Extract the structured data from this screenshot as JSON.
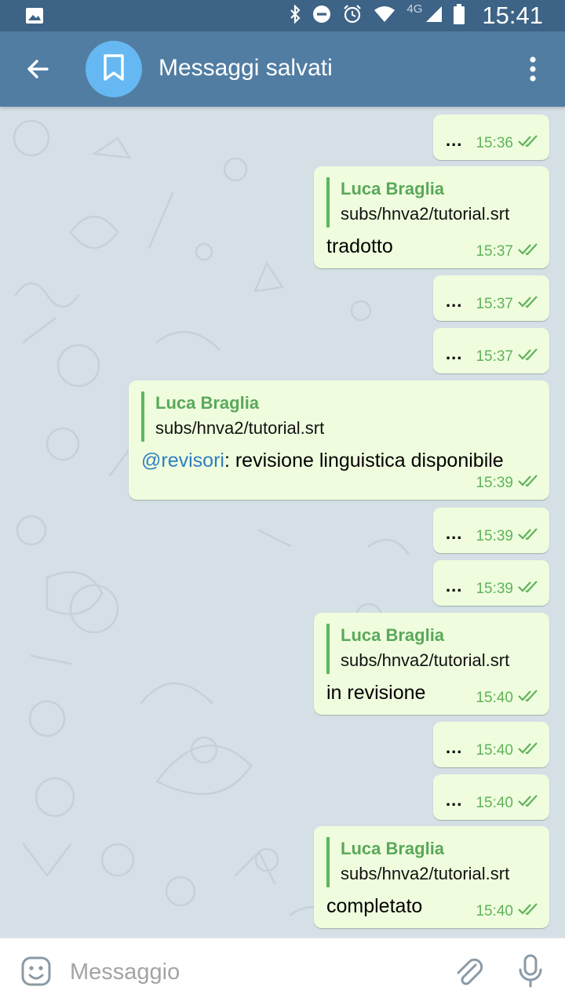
{
  "status_bar": {
    "time": "15:41",
    "network": "4G",
    "icons": [
      "image-icon",
      "bluetooth-icon",
      "dnd-icon",
      "alarm-icon",
      "wifi-icon",
      "signal-icon",
      "battery-icon"
    ]
  },
  "header": {
    "title": "Messaggi salvati",
    "avatar_icon": "bookmark-icon",
    "accent": "#517da2"
  },
  "messages": [
    {
      "type": "dots",
      "text": "...",
      "time": "15:36"
    },
    {
      "type": "reply",
      "reply_name": "Luca Braglia",
      "reply_file": "subs/hnva2/tutorial.srt",
      "text": "tradotto",
      "time": "15:37"
    },
    {
      "type": "dots",
      "text": "...",
      "time": "15:37"
    },
    {
      "type": "dots",
      "text": "...",
      "time": "15:37"
    },
    {
      "type": "reply",
      "reply_name": "Luca Braglia",
      "reply_file": "subs/hnva2/tutorial.srt",
      "mention": "@revisori",
      "text": ": revisione linguistica disponibile",
      "time": "15:39"
    },
    {
      "type": "dots",
      "text": "...",
      "time": "15:39"
    },
    {
      "type": "dots",
      "text": "...",
      "time": "15:39"
    },
    {
      "type": "reply",
      "reply_name": "Luca Braglia",
      "reply_file": "subs/hnva2/tutorial.srt",
      "text": "in revisione",
      "time": "15:40"
    },
    {
      "type": "dots",
      "text": "...",
      "time": "15:40"
    },
    {
      "type": "dots",
      "text": "...",
      "time": "15:40"
    },
    {
      "type": "reply",
      "reply_name": "Luca Braglia",
      "reply_file": "subs/hnva2/tutorial.srt",
      "text": "completato",
      "time": "15:40"
    }
  ],
  "input": {
    "placeholder": "Messaggio"
  },
  "colors": {
    "bubble": "#effdde",
    "checks": "#5fb35a",
    "reply_name": "#5aa85a",
    "mention": "#2f7fc1"
  }
}
